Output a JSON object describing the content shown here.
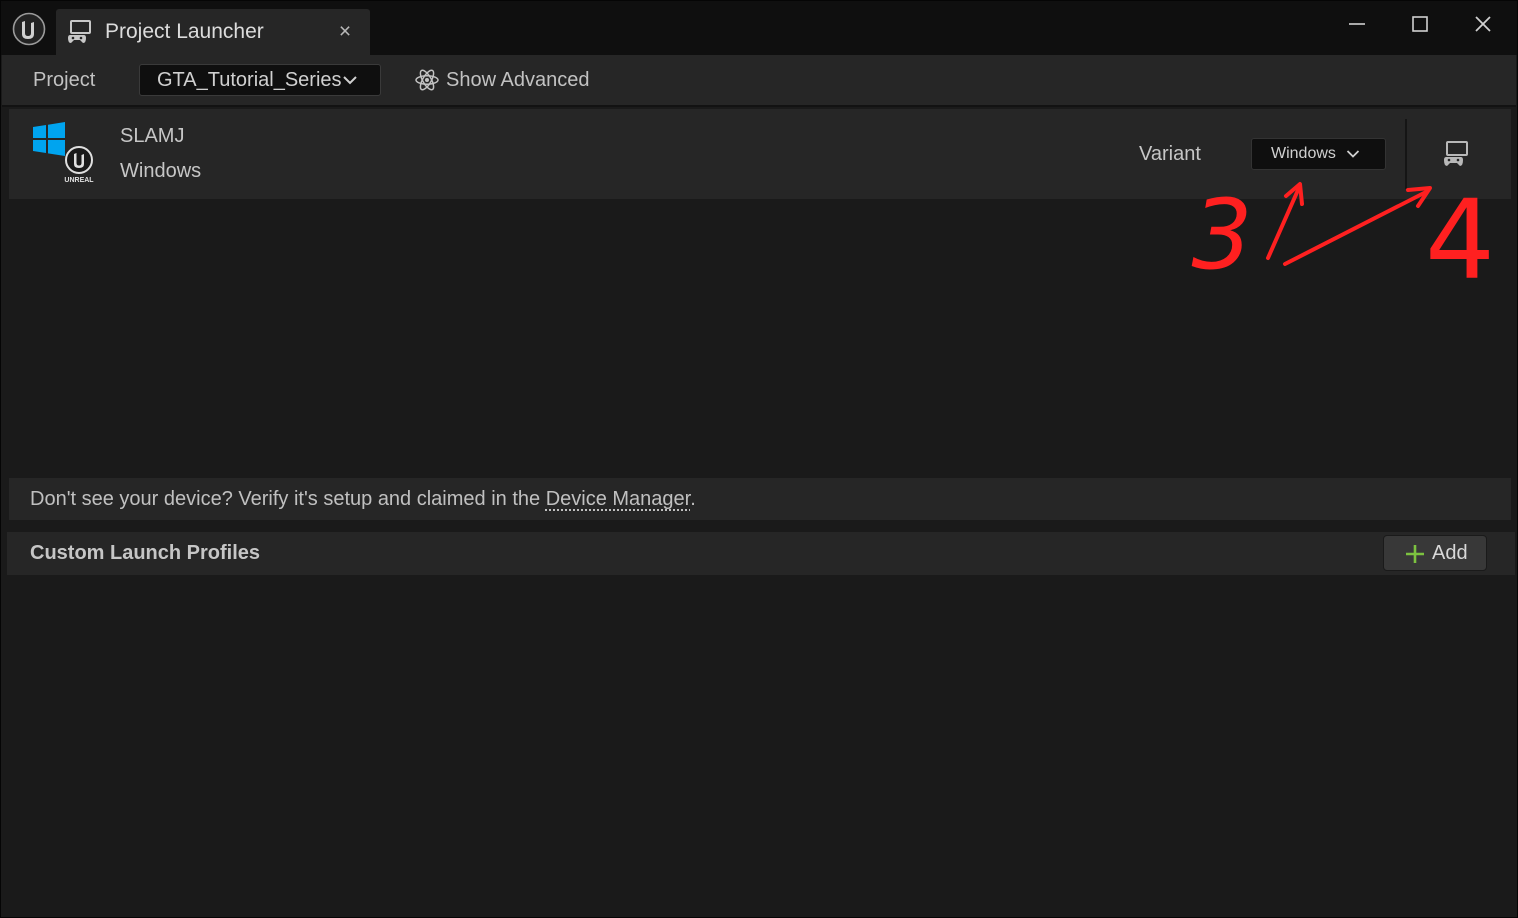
{
  "window": {
    "tab_title": "Project Launcher",
    "tab_close": "×"
  },
  "toolbar": {
    "project_label": "Project",
    "project_value": "GTA_Tutorial_Series",
    "show_advanced": "Show Advanced"
  },
  "device": {
    "name": "SLAMJ",
    "platform": "Windows",
    "variant_label": "Variant",
    "variant_value": "Windows",
    "logo_text": "UNREAL"
  },
  "annotations": {
    "label_3": "3",
    "label_4": "4",
    "color": "#ff2020"
  },
  "info": {
    "prefix": "Don't see your device? Verify it's setup and claimed in the ",
    "link": "Device Manager",
    "suffix": "."
  },
  "profiles": {
    "title": "Custom Launch Profiles",
    "add_label": "Add"
  },
  "colors": {
    "windows_blue": "#00a4ef",
    "add_green": "#7cc240"
  },
  "icons": {
    "app": "unreal-engine-logo-icon",
    "tab": "gamepad-monitor-icon",
    "advanced": "atom-icon",
    "launch": "gamepad-monitor-icon",
    "add": "plus-icon"
  }
}
